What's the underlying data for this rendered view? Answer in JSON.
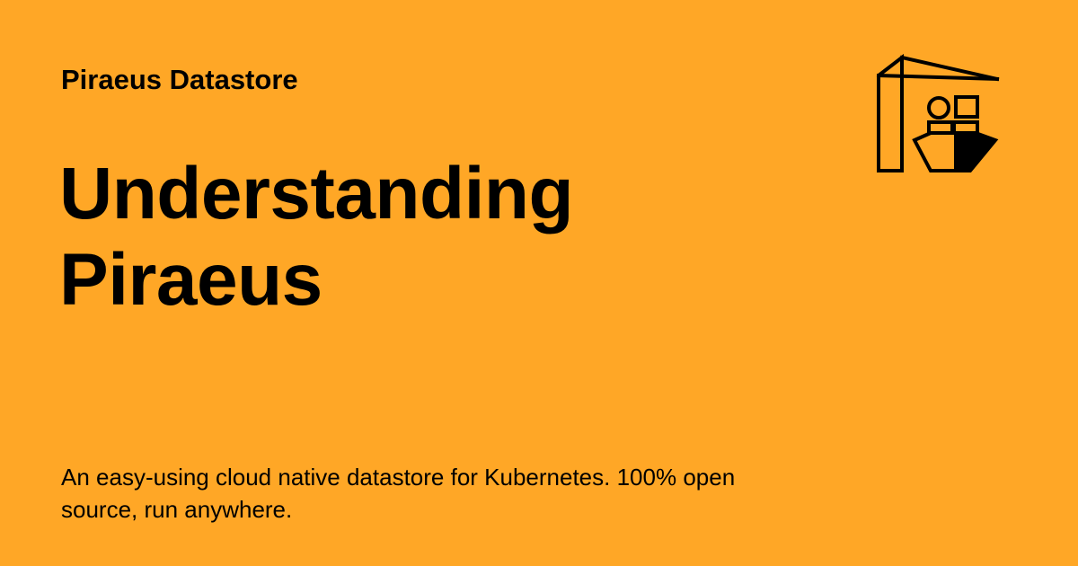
{
  "site": {
    "name": "Piraeus Datastore"
  },
  "page": {
    "title": "Understanding Piraeus",
    "description": "An easy-using cloud native datastore for Kubernetes. 100% open source, run anywhere."
  },
  "theme": {
    "background": "#FFA726",
    "foreground": "#000000"
  },
  "logo": {
    "icon": "piraeus-crane-ship-icon"
  }
}
